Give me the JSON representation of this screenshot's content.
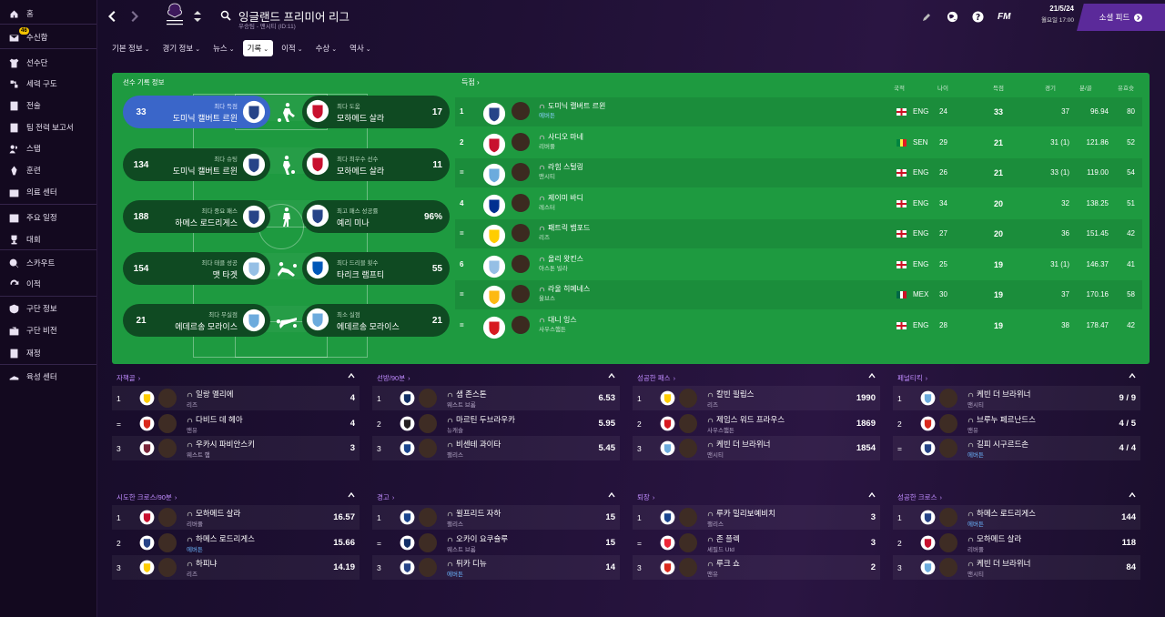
{
  "sidebar": {
    "items": [
      {
        "label": "홈",
        "icon": "home-icon"
      },
      {
        "label": "수신함",
        "icon": "inbox-icon",
        "badge": "46"
      },
      {
        "label": "선수단",
        "icon": "shirt-icon"
      },
      {
        "label": "세력 구도",
        "icon": "dynamics-icon"
      },
      {
        "label": "전술",
        "icon": "tactics-icon"
      },
      {
        "label": "팀 전력 보고서",
        "icon": "report-icon"
      },
      {
        "label": "스탭",
        "icon": "staff-icon"
      },
      {
        "label": "훈련",
        "icon": "training-icon"
      },
      {
        "label": "의료 센터",
        "icon": "medical-icon"
      },
      {
        "label": "주요 일정",
        "icon": "calendar-icon"
      },
      {
        "label": "대회",
        "icon": "trophy-icon"
      },
      {
        "label": "스카우트",
        "icon": "scouting-icon"
      },
      {
        "label": "이적",
        "icon": "transfer-icon"
      },
      {
        "label": "구단 정보",
        "icon": "club-info-icon"
      },
      {
        "label": "구단 비전",
        "icon": "club-vision-icon"
      },
      {
        "label": "재정",
        "icon": "finances-icon"
      },
      {
        "label": "육성 센터",
        "icon": "dev-centre-icon"
      }
    ]
  },
  "header": {
    "title": "잉글랜드 프리미어 리그",
    "subtitle": "우승팀 - 맨시티 (ID:11)",
    "logo_text": "Premier League",
    "date": "21/5/24",
    "date_sub": "월요일 17:00",
    "fm": "FM",
    "social_feed": "소셜 피드"
  },
  "tabs": [
    {
      "label": "기본 정보"
    },
    {
      "label": "경기 정보"
    },
    {
      "label": "뉴스"
    },
    {
      "label": "기록",
      "active": true
    },
    {
      "label": "이적"
    },
    {
      "label": "수상"
    },
    {
      "label": "역사"
    }
  ],
  "records": {
    "title": "선수 기록 정보",
    "rows": [
      {
        "left": {
          "value": "33",
          "caption": "최다 득점",
          "name": "도미닉 캘버트 르윈",
          "club_color": "#274488"
        },
        "right": {
          "value": "17",
          "caption": "최다 도움",
          "name": "모하메드 살라",
          "club_color": "#c8102e"
        },
        "action": "kick-icon"
      },
      {
        "left": {
          "value": "134",
          "caption": "최다 슈팅",
          "name": "도미닉 캘버트 르윈",
          "club_color": "#274488"
        },
        "right": {
          "value": "11",
          "caption": "최다 최우수 선수",
          "name": "모하메드 살라",
          "club_color": "#c8102e"
        },
        "action": "shoot-icon"
      },
      {
        "left": {
          "value": "188",
          "caption": "최다 중요 패스",
          "name": "하메스 로드리게스",
          "club_color": "#274488"
        },
        "right": {
          "value": "96%",
          "caption": "최고 패스 성공률",
          "name": "예리 미나",
          "club_color": "#274488"
        },
        "action": "pass-icon"
      },
      {
        "left": {
          "value": "154",
          "caption": "최다 태클 성공",
          "name": "맷 타겟",
          "club_color": "#95bfe5"
        },
        "right": {
          "value": "55",
          "caption": "최다 드리블 횟수",
          "name": "타리크 램프티",
          "club_color": "#0057b8"
        },
        "action": "tackle-icon"
      },
      {
        "left": {
          "value": "21",
          "caption": "최다 무실점",
          "name": "에데르송 모라이스",
          "club_color": "#6cabdd"
        },
        "right": {
          "value": "21",
          "caption": "최소 실점",
          "name": "에데르송 모라이스",
          "club_color": "#6cabdd"
        },
        "action": "save-icon"
      }
    ]
  },
  "scorers": {
    "title": "득점",
    "headers": {
      "nat": "국적",
      "age": "나이",
      "goals": "득점",
      "apps": "경기",
      "mpg": "분/골",
      "rating": "유효슛"
    },
    "rows": [
      {
        "pos": "1",
        "name": "도미닉 캘버트 르윈",
        "club": "에버튼",
        "club_blue": true,
        "club_color": "#274488",
        "nat": "ENG",
        "age": "24",
        "goals": "33",
        "apps": "37",
        "mpg": "96.94",
        "rating": "80"
      },
      {
        "pos": "2",
        "name": "사디오 마네",
        "club": "리버풀",
        "club_color": "#c8102e",
        "nat": "SEN",
        "age": "29",
        "goals": "21",
        "apps": "31 (1)",
        "mpg": "121.86",
        "rating": "52"
      },
      {
        "pos": "=",
        "name": "라힘 스털링",
        "club": "맨시티",
        "club_color": "#6cabdd",
        "nat": "ENG",
        "age": "26",
        "goals": "21",
        "apps": "33 (1)",
        "mpg": "119.00",
        "rating": "54"
      },
      {
        "pos": "4",
        "name": "제이미 바디",
        "club": "레스터",
        "club_color": "#003090",
        "nat": "ENG",
        "age": "34",
        "goals": "20",
        "apps": "32",
        "mpg": "138.25",
        "rating": "51"
      },
      {
        "pos": "=",
        "name": "패트릭 뱀포드",
        "club": "리즈",
        "club_color": "#ffcd00",
        "nat": "ENG",
        "age": "27",
        "goals": "20",
        "apps": "36",
        "mpg": "151.45",
        "rating": "42"
      },
      {
        "pos": "6",
        "name": "올리 왓킨스",
        "club": "아스톤 빌라",
        "club_color": "#95bfe5",
        "nat": "ENG",
        "age": "25",
        "goals": "19",
        "apps": "31 (1)",
        "mpg": "146.37",
        "rating": "41"
      },
      {
        "pos": "=",
        "name": "라울 히메네스",
        "club": "울브스",
        "club_color": "#fdb913",
        "nat": "MEX",
        "age": "30",
        "goals": "19",
        "apps": "37",
        "mpg": "170.16",
        "rating": "58"
      },
      {
        "pos": "=",
        "name": "대니 잉스",
        "club": "사우스햄튼",
        "club_color": "#d71920",
        "nat": "ENG",
        "age": "28",
        "goals": "19",
        "apps": "38",
        "mpg": "178.47",
        "rating": "42"
      }
    ]
  },
  "tables": [
    {
      "title": "자책골",
      "rows": [
        {
          "pos": "1",
          "name": "일랑 멜리에",
          "club": "리즈",
          "club_color": "#ffcd00",
          "value": "4"
        },
        {
          "pos": "=",
          "name": "다비드 데 헤아",
          "club": "맨유",
          "club_color": "#da291c",
          "value": "4"
        },
        {
          "pos": "3",
          "name": "우카시 파비안스키",
          "club": "웨스트 햄",
          "club_color": "#7a263a",
          "value": "3"
        }
      ]
    },
    {
      "title": "선방/90분",
      "rows": [
        {
          "pos": "1",
          "name": "샘 존스톤",
          "club": "웨스트 브롬",
          "club_color": "#122f67",
          "value": "6.53"
        },
        {
          "pos": "2",
          "name": "마르틴 두브라우카",
          "club": "뉴캐슬",
          "club_color": "#241f20",
          "value": "5.95"
        },
        {
          "pos": "3",
          "name": "비센테 과이타",
          "club": "팰리스",
          "club_color": "#1b458f",
          "value": "5.45"
        }
      ]
    },
    {
      "title": "성공한 패스",
      "rows": [
        {
          "pos": "1",
          "name": "칼빈 필립스",
          "club": "리즈",
          "club_color": "#ffcd00",
          "value": "1990"
        },
        {
          "pos": "2",
          "name": "제임스 워드 프라우스",
          "club": "사우스햄튼",
          "club_color": "#d71920",
          "value": "1869"
        },
        {
          "pos": "3",
          "name": "케빈 더 브라위너",
          "club": "맨시티",
          "club_color": "#6cabdd",
          "value": "1854"
        }
      ]
    },
    {
      "title": "페널티킥",
      "rows": [
        {
          "pos": "1",
          "name": "케빈 더 브라위너",
          "club": "맨시티",
          "club_color": "#6cabdd",
          "value": "9 / 9"
        },
        {
          "pos": "2",
          "name": "브루누 페르난드스",
          "club": "맨유",
          "club_color": "#da291c",
          "value": "4 / 5"
        },
        {
          "pos": "=",
          "name": "길피 시구르드손",
          "club": "에버튼",
          "club_blue": true,
          "club_color": "#274488",
          "value": "4 / 4"
        }
      ]
    },
    {
      "title": "시도한 크로스/90분",
      "rows": [
        {
          "pos": "1",
          "name": "모하메드 살라",
          "club": "리버풀",
          "club_color": "#c8102e",
          "value": "16.57"
        },
        {
          "pos": "2",
          "name": "하메스 로드리게스",
          "club": "에버튼",
          "club_blue": true,
          "club_color": "#274488",
          "value": "15.66"
        },
        {
          "pos": "3",
          "name": "하피냐",
          "club": "리즈",
          "club_color": "#ffcd00",
          "value": "14.19"
        }
      ]
    },
    {
      "title": "경고",
      "rows": [
        {
          "pos": "1",
          "name": "윌프리드 자하",
          "club": "팰리스",
          "club_color": "#1b458f",
          "value": "15"
        },
        {
          "pos": "=",
          "name": "오카이 요쿠슐루",
          "club": "웨스트 브롬",
          "club_color": "#122f67",
          "value": "15"
        },
        {
          "pos": "3",
          "name": "튀카 디뉴",
          "club": "에버튼",
          "club_blue": true,
          "club_color": "#274488",
          "value": "14"
        }
      ]
    },
    {
      "title": "퇴장",
      "rows": [
        {
          "pos": "1",
          "name": "루카 밀리보예비치",
          "club": "팰리스",
          "club_color": "#1b458f",
          "value": "3"
        },
        {
          "pos": "=",
          "name": "존 플렉",
          "club": "셰필드 Utd",
          "club_color": "#ee2737",
          "value": "3"
        },
        {
          "pos": "3",
          "name": "루크 쇼",
          "club": "맨유",
          "club_color": "#da291c",
          "value": "2"
        }
      ]
    },
    {
      "title": "성공한 크로스",
      "rows": [
        {
          "pos": "1",
          "name": "하메스 로드리게스",
          "club": "에버튼",
          "club_blue": true,
          "club_color": "#274488",
          "value": "144"
        },
        {
          "pos": "2",
          "name": "모하메드 살라",
          "club": "리버풀",
          "club_color": "#c8102e",
          "value": "118"
        },
        {
          "pos": "3",
          "name": "케빈 더 브라위너",
          "club": "맨시티",
          "club_color": "#6cabdd",
          "value": "84"
        }
      ]
    }
  ]
}
